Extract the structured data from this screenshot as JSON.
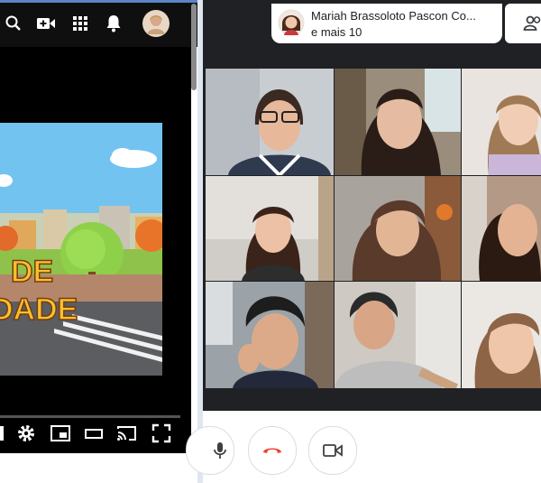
{
  "meet": {
    "host_name": "Mariah Brassoloto Pascon Co...",
    "participants_more": "e mais 10"
  },
  "video_title_lines": [
    "DE",
    "DADE"
  ],
  "colors": {
    "meet_bg": "#202124",
    "end_call_red": "#ea4335",
    "youtube_topbar": "#0f0f0f"
  },
  "icons": {
    "youtube_topbar": [
      "search-icon",
      "create-video-icon",
      "apps-grid-icon",
      "notifications-bell-icon",
      "avatar"
    ],
    "youtube_player_controls": [
      "settings-gear-icon",
      "miniplayer-icon",
      "theater-mode-icon",
      "cast-icon",
      "fullscreen-icon"
    ],
    "meet_controls": [
      "microphone-icon",
      "end-call-icon",
      "camera-icon",
      "people-icon"
    ]
  }
}
